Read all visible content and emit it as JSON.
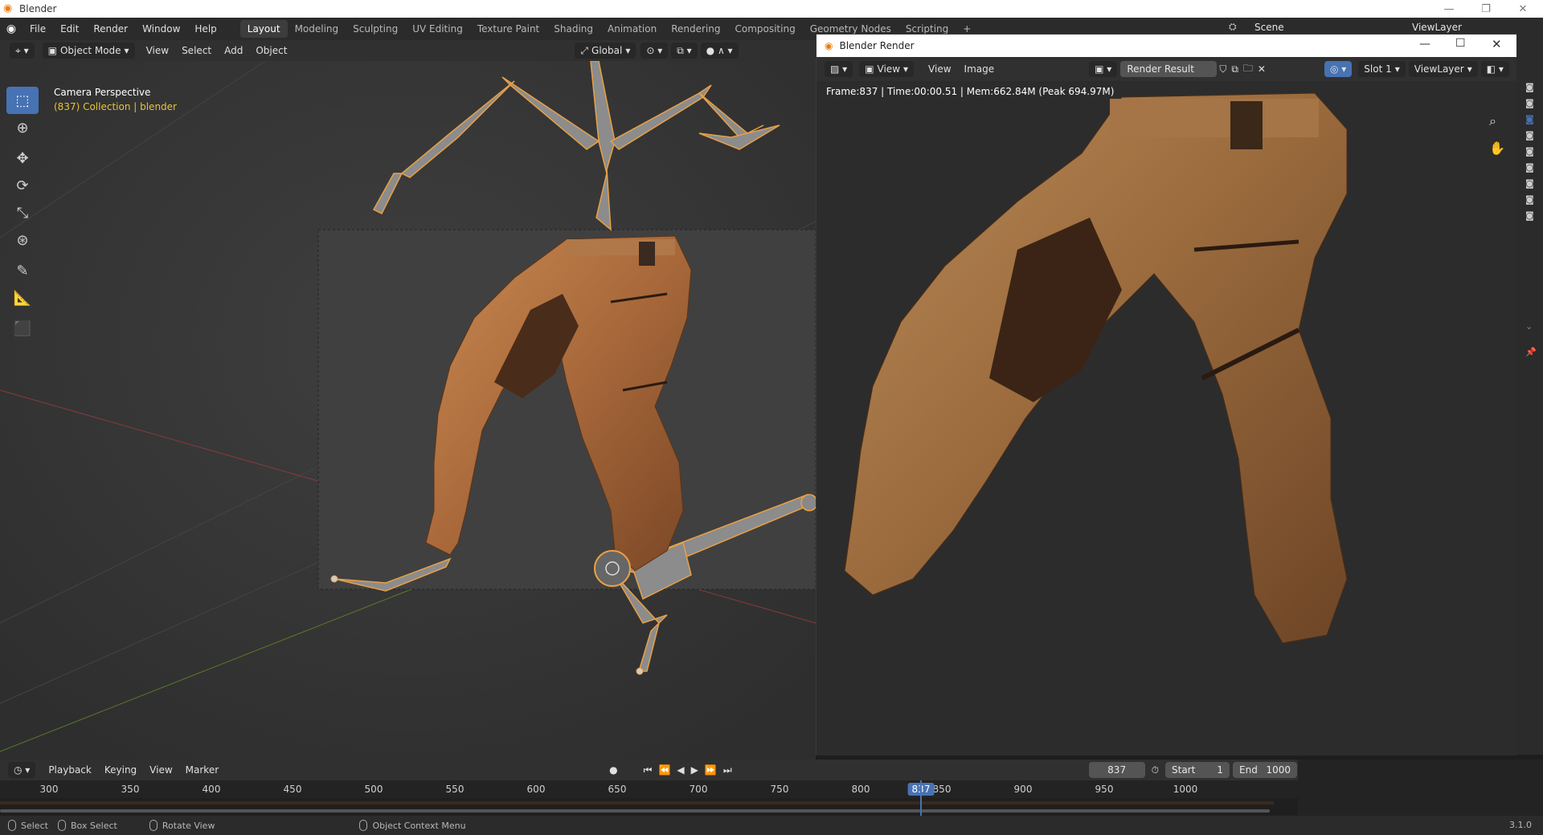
{
  "window": {
    "title": "Blender",
    "version": "3.1.0"
  },
  "menu": [
    "File",
    "Edit",
    "Render",
    "Window",
    "Help"
  ],
  "workspaces": [
    "Layout",
    "Modeling",
    "Sculpting",
    "UV Editing",
    "Texture Paint",
    "Shading",
    "Animation",
    "Rendering",
    "Compositing",
    "Geometry Nodes",
    "Scripting"
  ],
  "active_workspace": "Layout",
  "scene": {
    "scene_name": "Scene",
    "view_layer": "ViewLayer"
  },
  "viewport": {
    "mode": "Object Mode",
    "menus": [
      "View",
      "Select",
      "Add",
      "Object"
    ],
    "transform_orientation": "Global",
    "overlay_title": "Camera Perspective",
    "overlay_subtitle": "(837) Collection | blender"
  },
  "render_window": {
    "title": "Blender Render",
    "menus": [
      "View",
      "View",
      "Image"
    ],
    "image_name": "Render Result",
    "slot": "Slot 1",
    "view_layer": "ViewLayer",
    "info": "Frame:837 | Time:00:00.51 | Mem:662.84M (Peak 694.97M)"
  },
  "timeline": {
    "menus": [
      "Playback",
      "Keying",
      "View",
      "Marker"
    ],
    "current_frame": "837",
    "start_label": "Start",
    "start_value": "1",
    "end_label": "End",
    "end_value": "1000",
    "ticks": [
      "300",
      "350",
      "400",
      "450",
      "500",
      "550",
      "600",
      "650",
      "700",
      "750",
      "800",
      "850",
      "900",
      "950",
      "1000"
    ]
  },
  "statusbar": {
    "select": "Select",
    "box_select": "Box Select",
    "rotate_view": "Rotate View",
    "context_menu": "Object Context Menu"
  },
  "colors": {
    "accent": "#4772b3",
    "selected_orange": "#e8a046",
    "collection_yellow": "#e8c13a"
  },
  "icons": [
    "blender-logo-icon",
    "select-box-icon",
    "cursor-icon",
    "move-icon",
    "rotate-icon",
    "scale-icon",
    "transform-icon",
    "annotate-icon",
    "measure-icon",
    "add-cube-icon",
    "zoom-icon",
    "hand-icon",
    "camera-icon",
    "play-icon"
  ]
}
